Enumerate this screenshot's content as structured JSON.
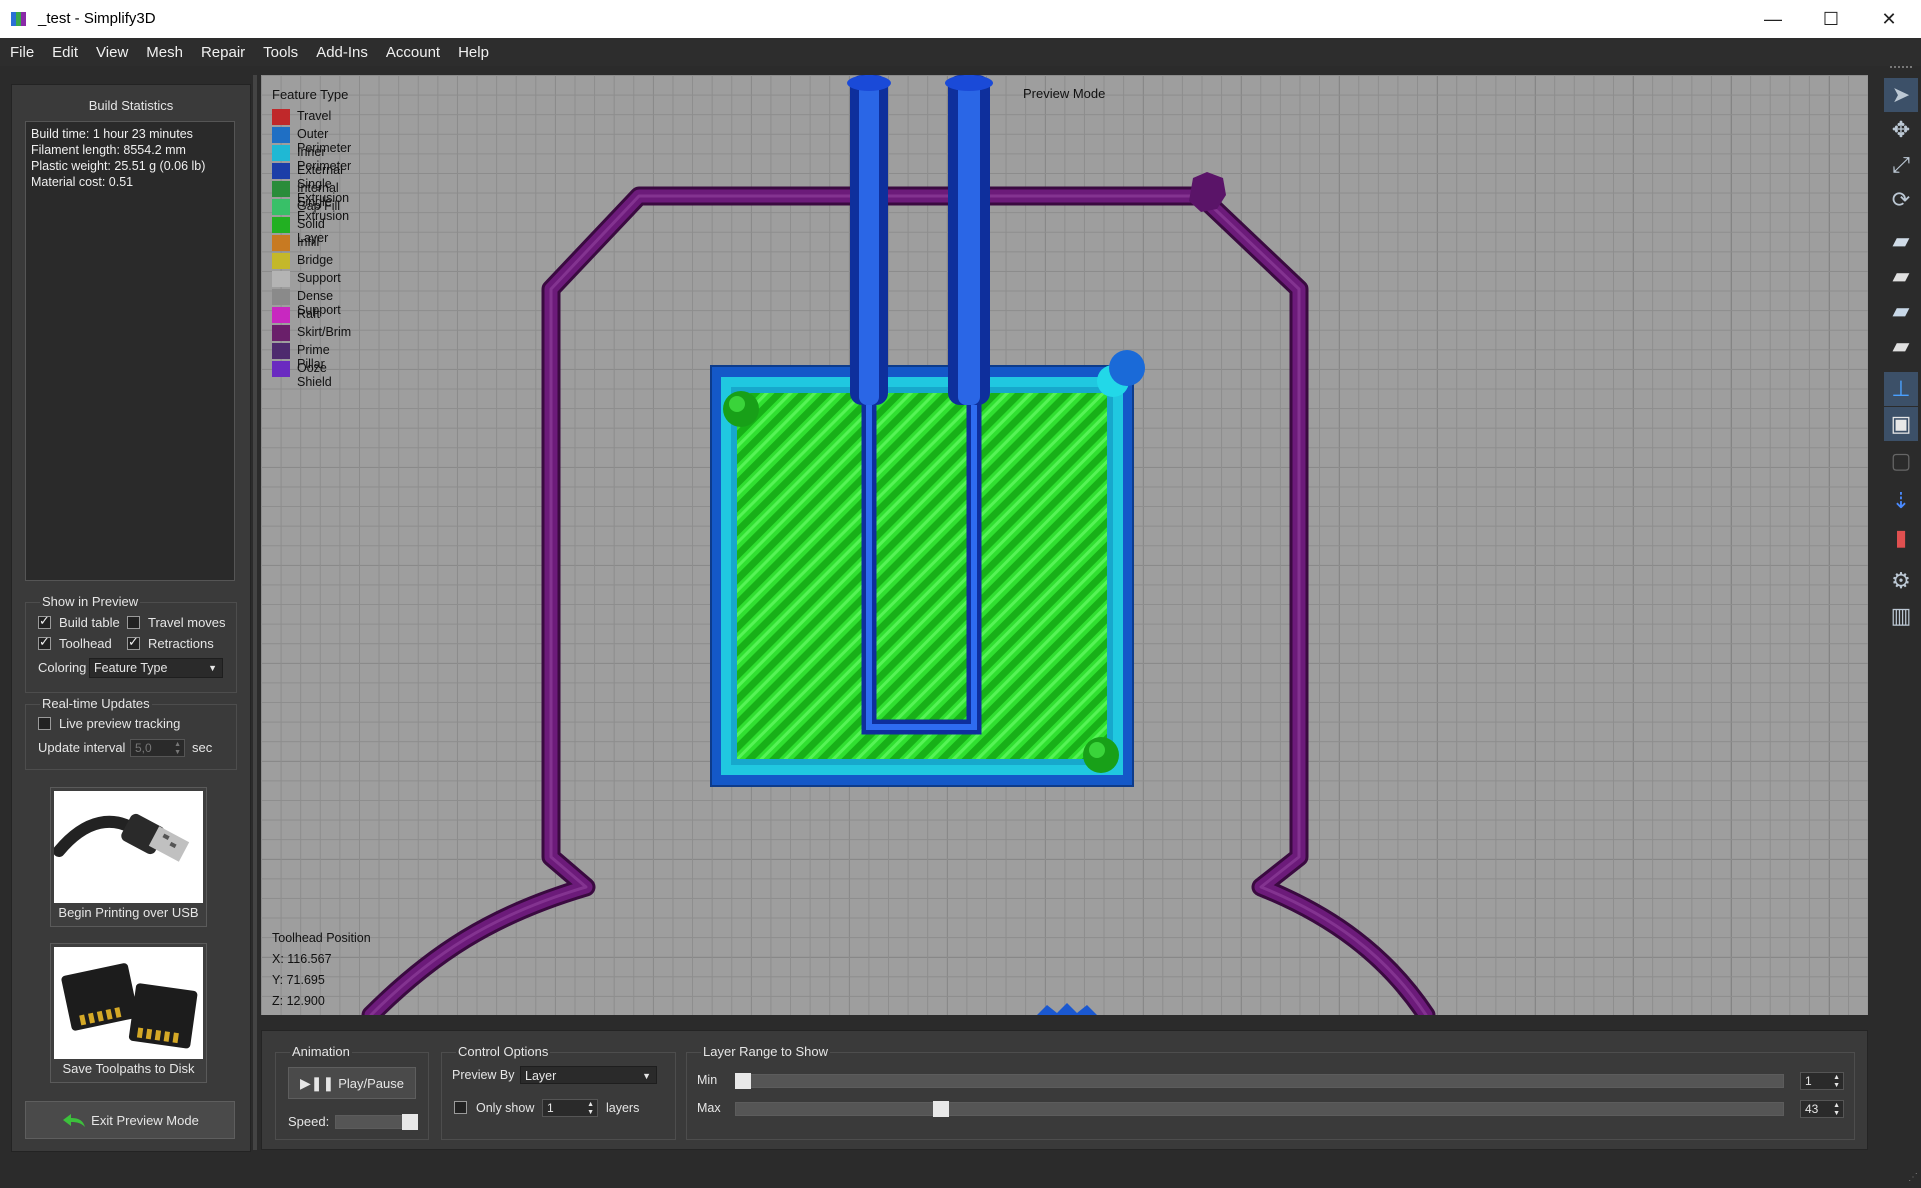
{
  "window": {
    "title": "_test - Simplify3D",
    "minimize": "—",
    "maximize": "☐",
    "close": "✕"
  },
  "menu": [
    "File",
    "Edit",
    "View",
    "Mesh",
    "Repair",
    "Tools",
    "Add-Ins",
    "Account",
    "Help"
  ],
  "build_statistics": {
    "title": "Build Statistics",
    "lines": [
      "Build time: 1 hour 23 minutes",
      "Filament length: 8554.2 mm",
      "Plastic weight: 25.51 g (0.06 lb)",
      "Material cost: 0.51"
    ]
  },
  "show_in_preview": {
    "title": "Show in Preview",
    "build_table": "Build table",
    "travel_moves": "Travel moves",
    "toolhead": "Toolhead",
    "retractions": "Retractions",
    "coloring_label": "Coloring",
    "coloring_value": "Feature Type"
  },
  "realtime_updates": {
    "title": "Real-time Updates",
    "live_tracking": "Live preview tracking",
    "interval_label": "Update interval",
    "interval_value": "5,0",
    "interval_unit": "sec"
  },
  "actions": {
    "usb": "Begin Printing over USB",
    "disk": "Save Toolpaths to Disk",
    "exit": "Exit Preview Mode"
  },
  "legend": {
    "title": "Feature Type",
    "items": [
      {
        "label": "Travel",
        "color": "#c0282a"
      },
      {
        "label": "Outer Perimeter",
        "color": "#1f6fc4"
      },
      {
        "label": "Inner Perimeter",
        "color": "#1fb8d4"
      },
      {
        "label": "External Single Extrusion",
        "color": "#1c3ea8"
      },
      {
        "label": "Internal Single Extrusion",
        "color": "#2a8c3a"
      },
      {
        "label": "Gap Fill",
        "color": "#38c068"
      },
      {
        "label": "Solid Layer",
        "color": "#22b022"
      },
      {
        "label": "Infill",
        "color": "#c87a22"
      },
      {
        "label": "Bridge",
        "color": "#c4b82a"
      },
      {
        "label": "Support",
        "color": "#b4b4b4"
      },
      {
        "label": "Dense Support",
        "color": "#8a8a8a"
      },
      {
        "label": "Raft",
        "color": "#c828c0"
      },
      {
        "label": "Skirt/Brim",
        "color": "#6a1f6a"
      },
      {
        "label": "Prime Pillar",
        "color": "#4e2a6e"
      },
      {
        "label": "Ooze Shield",
        "color": "#6a2ac0"
      }
    ]
  },
  "preview_mode": "Preview Mode",
  "toolhead_position": {
    "title": "Toolhead Position",
    "x": "X: 116.567",
    "y": "Y: 71.695",
    "z": "Z: 12.900"
  },
  "animation": {
    "title": "Animation",
    "play_pause": "Play/Pause",
    "speed_label": "Speed:"
  },
  "control_options": {
    "title": "Control Options",
    "preview_by_label": "Preview By",
    "preview_by_value": "Layer",
    "only_show_label": "Only show",
    "only_show_value": "1",
    "layers_label": "layers"
  },
  "layer_range": {
    "title": "Layer Range to Show",
    "min_label": "Min",
    "max_label": "Max",
    "min_value": "1",
    "max_value": "43"
  },
  "colors": {
    "skirt": "#5c1266",
    "outer_perimeter": "#1a6ad8",
    "inner_perimeter": "#22d0e8",
    "solid_layer": "#20d020",
    "single_extrusion": "#1438c8"
  }
}
